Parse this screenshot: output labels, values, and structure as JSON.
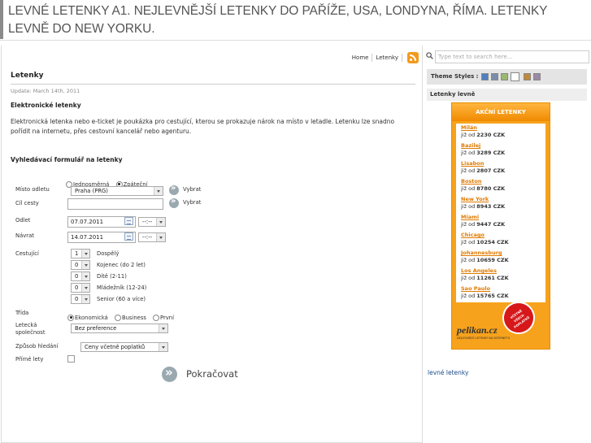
{
  "header": {
    "title": "LEVNÉ LETENKY A1. NEJLEVNĚJŠÍ LETENKY DO PAŘÍŽE, USA, LONDYNA, ŘÍMA. LETENKY LEVNĚ DO NEW YORKU."
  },
  "nav": {
    "home": "Home",
    "letenky": "Letenky",
    "rss_icon": "rss-feed-icon"
  },
  "page": {
    "title": "Letenky",
    "update": "Update: March 14th, 2011",
    "etick_heading": "Elektronické letenky",
    "paragraph": "Elektronická letenka nebo e-ticket je poukázka pro cestující, kterou se prokazuje nárok na místo v letadle. Letenku lze snadno pořídit na internetu, přes cestovní kancelář nebo agenturu.",
    "form_heading": "Vyhledávací formulář na letenky"
  },
  "form": {
    "trip_options": [
      "Jednosměrná",
      "Zpáteční"
    ],
    "trip_selected": 1,
    "from_label": "Místo odletu",
    "from_value": "Praha (PRG)",
    "pick_label": "Vybrat",
    "to_label": "Cíl cesty",
    "to_value": "",
    "depart_label": "Odlet",
    "depart_value": "07.07.2011",
    "return_label": "Návrat",
    "return_value": "14.07.2011",
    "time_value": "--:--",
    "travelers_label": "Cestující",
    "travelers": [
      {
        "count": "1",
        "label": "Dospělý"
      },
      {
        "count": "0",
        "label": "Kojenec (do 2 let)"
      },
      {
        "count": "0",
        "label": "Dítě (2-11)"
      },
      {
        "count": "0",
        "label": "Mládežník (12-24)"
      },
      {
        "count": "0",
        "label": "Senior (60 a více)"
      }
    ],
    "class_label": "Třída",
    "class_options": [
      "Ekonomická",
      "Business",
      "První"
    ],
    "class_selected": 0,
    "airline_label_1": "Letecká",
    "airline_label_2": "společnost",
    "airline_value": "Bez preference",
    "search_mode_label": "Způsob hledání",
    "search_mode_value": "Ceny včetně poplatků",
    "direct_label": "Přímé lety",
    "continue_label": "Pokračovat"
  },
  "sidebar": {
    "search_placeholder": "Type text to search here...",
    "theme_label": "Theme Styles :",
    "theme_colors": [
      "#4f7fc0",
      "#7a8ea8",
      "#9bb870",
      "#ffffff",
      "#c08a3a",
      "#9a8aa6"
    ],
    "section_title": "Letenky levně",
    "banner_title": "AKČNÍ LETENKY",
    "deals": [
      {
        "city": "Milán",
        "price": "2230 CZK"
      },
      {
        "city": "Bazilej",
        "price": "3289 CZK"
      },
      {
        "city": "Lisabon",
        "price": "2807 CZK"
      },
      {
        "city": "Boston",
        "price": "8780 CZK"
      },
      {
        "city": "New York",
        "price": "8943 CZK"
      },
      {
        "city": "Miami",
        "price": "9447 CZK"
      },
      {
        "city": "Chicago",
        "price": "10254 CZK"
      },
      {
        "city": "Johannesburg",
        "price": "10659 CZK"
      },
      {
        "city": "Los Angeles",
        "price": "11261 CZK"
      },
      {
        "city": "Sao Paulo",
        "price": "15765 CZK"
      }
    ],
    "price_prefix": "již od",
    "seal_lines": [
      "VČETNĚ",
      "VŠECH",
      "POPLATKŮ"
    ],
    "logo": "pelikan.cz",
    "logo_sub": "NEJLEVNĚJŠÍ LETENKY NA INTERNETU",
    "link": "levné letenky"
  }
}
